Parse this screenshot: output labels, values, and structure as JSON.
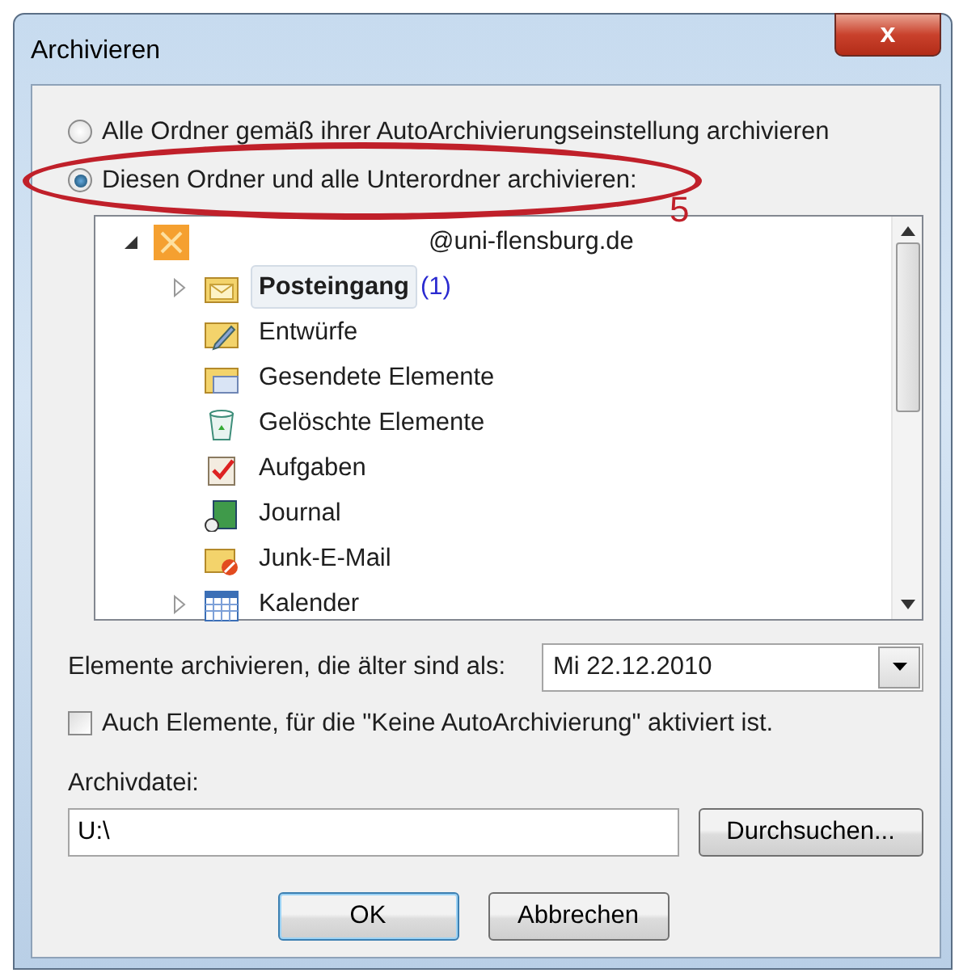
{
  "window": {
    "title": "Archivieren",
    "close": "x"
  },
  "scope_options": [
    {
      "label": "Alle Ordner gemäß ihrer AutoArchivierungseinstellung archivieren",
      "selected": false
    },
    {
      "label": "Diesen Ordner und alle Unterordner archivieren:",
      "selected": true
    }
  ],
  "annotation": {
    "label": "5"
  },
  "folder_tree": {
    "account": {
      "label": "@uni-flensburg.de",
      "expanded": true
    },
    "children": [
      {
        "label": "Posteingang",
        "count": "(1)",
        "expandable": true,
        "expanded": false,
        "selected": true
      },
      {
        "label": "Entwürfe",
        "expandable": false,
        "selected": false
      },
      {
        "label": "Gesendete Elemente",
        "expandable": false,
        "selected": false
      },
      {
        "label": "Gelöschte Elemente",
        "expandable": false,
        "selected": false
      },
      {
        "label": "Aufgaben",
        "expandable": false,
        "selected": false
      },
      {
        "label": "Journal",
        "expandable": false,
        "selected": false
      },
      {
        "label": "Junk-E-Mail",
        "expandable": false,
        "selected": false
      },
      {
        "label": "Kalender",
        "expandable": true,
        "expanded": false,
        "selected": false
      }
    ]
  },
  "older_than": {
    "label": "Elemente archivieren, die älter sind als:",
    "value": "Mi 22.12.2010"
  },
  "include_no_autoarchive": {
    "label": "Auch Elemente, für die \"Keine AutoArchivierung\" aktiviert ist.",
    "checked": false
  },
  "archive_file": {
    "label": "Archivdatei:",
    "value": "U:\\"
  },
  "buttons": [
    {
      "label": "Durchsuchen...",
      "default": false
    },
    {
      "label": "OK",
      "default": true
    },
    {
      "label": "Abbrechen",
      "default": false
    }
  ]
}
